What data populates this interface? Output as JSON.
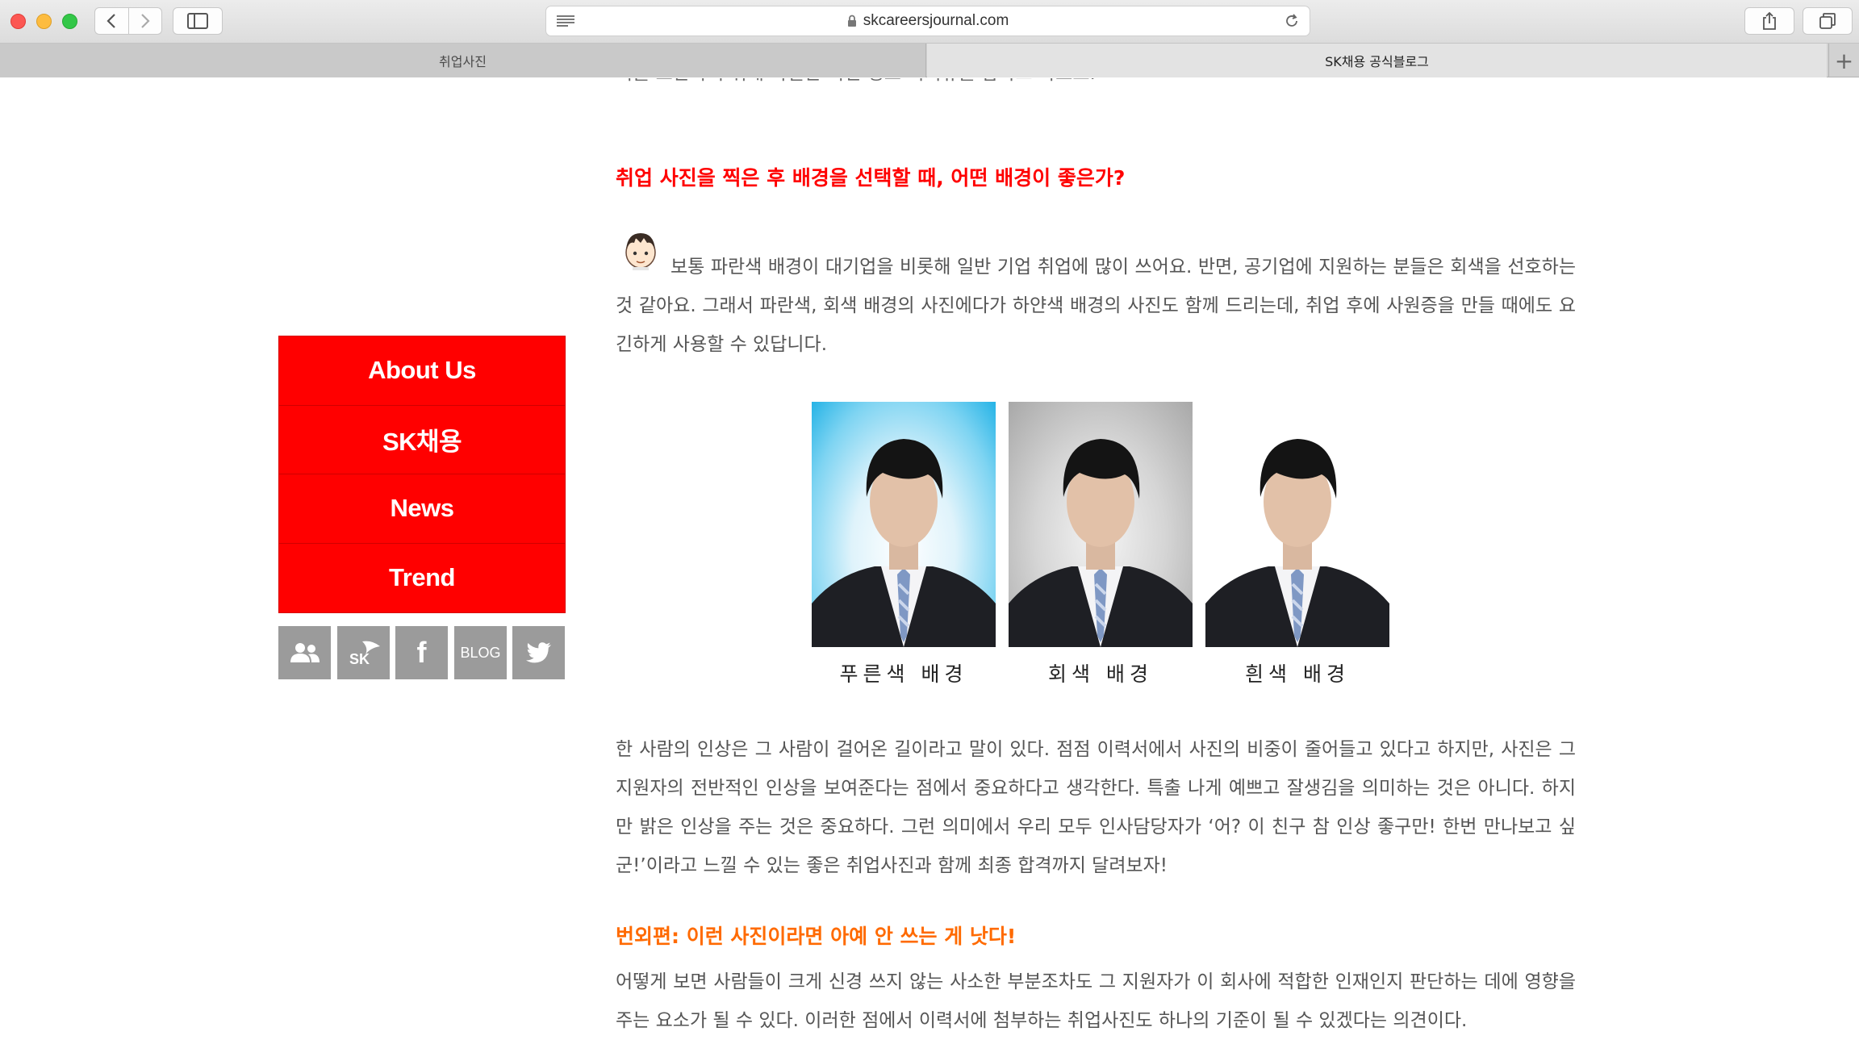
{
  "browser": {
    "url": "skcareersjournal.com",
    "tabs": [
      {
        "label": "취업사진"
      },
      {
        "label": "SK채용 공식블로그"
      }
    ],
    "new_tab_label": "+"
  },
  "article": {
    "cut_line": "이를 보완하기 위해 특별한 이번 정보 커리큐를 갑자고 하보요.",
    "section_heading": "취업 사진을 찍은 후 배경을 선택할 때, 어떤 배경이 좋은가?",
    "paragraph_1": "보통 파란색 배경이 대기업을 비롯해 일반 기업 취업에 많이 쓰어요. 반면, 공기업에 지원하는 분들은 회색을 선호하는 것 같아요. 그래서 파란색, 회색 배경의 사진에다가 하얀색 배경의 사진도 함께 드리는데, 취업 후에 사원증을 만들 때에도 요긴하게 사용할 수 있답니다.",
    "photos": [
      {
        "caption": "푸른색 배경",
        "background": "blue"
      },
      {
        "caption": "회색 배경",
        "background": "gray"
      },
      {
        "caption": "흰색 배경",
        "background": "white"
      }
    ],
    "paragraph_2": "한 사람의 인상은 그 사람이 걸어온 길이라고 말이 있다. 점점 이력서에서 사진의 비중이 줄어들고 있다고 하지만, 사진은 그 지원자의 전반적인 인상을 보여준다는 점에서 중요하다고 생각한다. 특출 나게 예쁘고 잘생김을 의미하는 것은 아니다. 하지만 밝은 인상을 주는 것은 중요하다. 그런 의미에서 우리 모두 인사담당자가 ‘어? 이 친구 참 인상 좋구만! 한번 만나보고 싶군!’이라고 느낄 수 있는 좋은 취업사진과 함께 최종 합격까지 달려보자!",
    "bonus_heading": "번외편: 이런 사진이라면 아예 안 쓰는 게 낫다!",
    "paragraph_3": "어떻게 보면 사람들이 크게 신경 쓰지 않는 사소한 부분조차도 그 지원자가 이 회사에 적합한 인재인지 판단하는 데에 영향을 주는 요소가 될 수 있다. 이러한 점에서 이력서에 첨부하는 취업사진도 하나의 기준이 될 수 있겠다는 의견이다."
  },
  "sidebar": {
    "menu": [
      {
        "label": "About Us"
      },
      {
        "label": "SK채용"
      },
      {
        "label": "News"
      },
      {
        "label": "Trend"
      }
    ],
    "social": {
      "sk_label": "SK",
      "facebook_label": "f",
      "blog_label": "BLOG"
    }
  },
  "colors": {
    "brand_red": "#ff0000",
    "heading_orange": "#ff6a00",
    "social_gray": "#9b9b9b"
  }
}
